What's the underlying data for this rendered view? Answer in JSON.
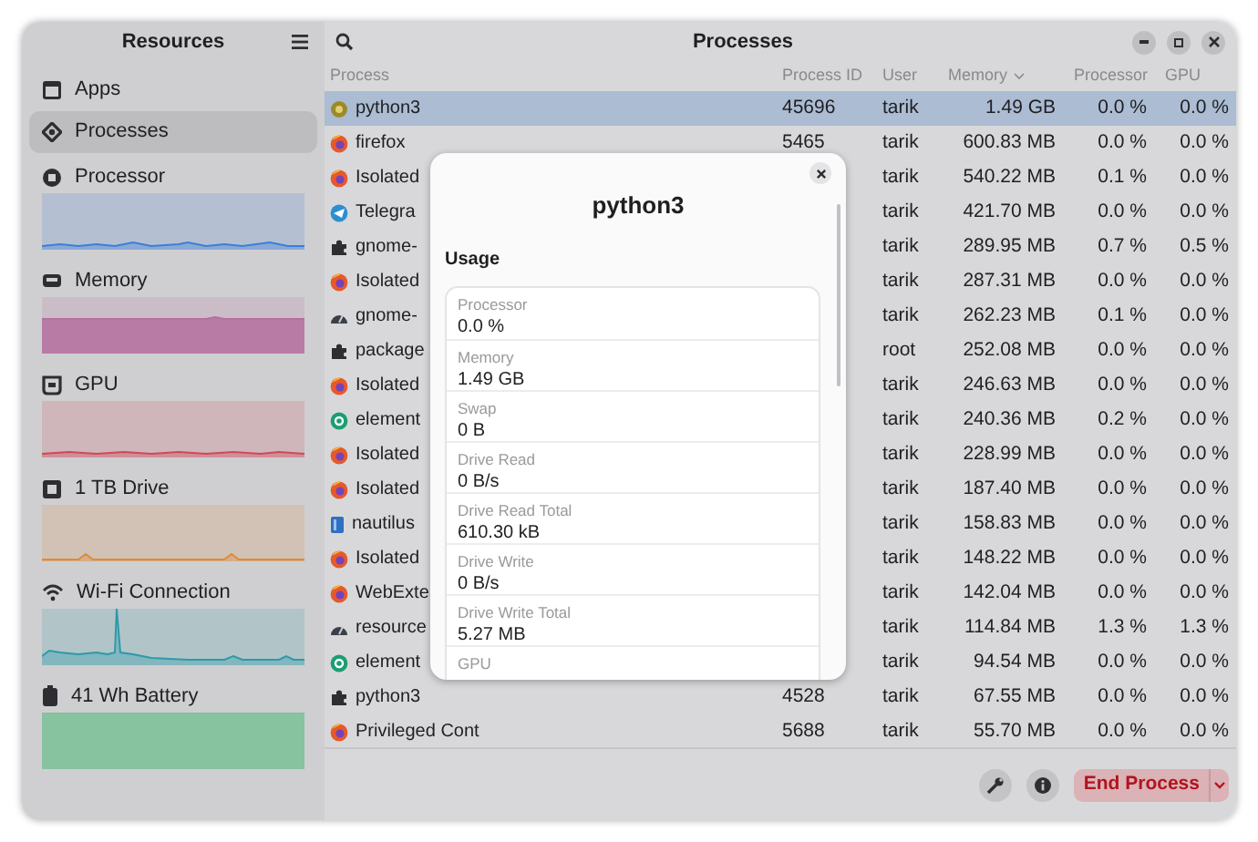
{
  "sidebar": {
    "title": "Resources",
    "nav": [
      {
        "label": "Apps",
        "kind": "apps",
        "selected": false
      },
      {
        "label": "Processes",
        "kind": "processes",
        "selected": true
      }
    ],
    "resources": [
      {
        "label": "Processor",
        "kind": "cpu",
        "color": "#3b7fd9"
      },
      {
        "label": "Memory",
        "kind": "memory",
        "color": "#b5709f"
      },
      {
        "label": "GPU",
        "kind": "gpu",
        "color": "#d0485a"
      },
      {
        "label": "1 TB Drive",
        "kind": "drive",
        "color": "#e08a3a"
      },
      {
        "label": "Wi-Fi Connection",
        "kind": "wifi",
        "color": "#2d9aa8"
      },
      {
        "label": "41 Wh Battery",
        "kind": "battery",
        "color": "#7cc198"
      }
    ]
  },
  "header": {
    "title": "Processes"
  },
  "table": {
    "columns": [
      "Process",
      "Process ID",
      "User",
      "Memory",
      "Processor",
      "GPU"
    ],
    "rows": [
      {
        "kind": "python",
        "name": "python3",
        "pid": "45696",
        "user": "tarik",
        "memory": "1.49 GB",
        "processor": "0.0 %",
        "gpu": "0.0 %",
        "selected": true
      },
      {
        "kind": "firefox",
        "name": "firefox",
        "pid": "5465",
        "user": "tarik",
        "memory": "600.83 MB",
        "processor": "0.0 %",
        "gpu": "0.0 %",
        "selected": false
      },
      {
        "kind": "firefox",
        "name": "Isolated",
        "user": "tarik",
        "memory": "540.22 MB",
        "processor": "0.1 %",
        "gpu": "0.0 %",
        "selected": false
      },
      {
        "kind": "telegram",
        "name": "Telegra",
        "user": "tarik",
        "memory": "421.70 MB",
        "processor": "0.0 %",
        "gpu": "0.0 %",
        "selected": false
      },
      {
        "kind": "puzzle",
        "name": "gnome-",
        "user": "tarik",
        "memory": "289.95 MB",
        "processor": "0.7 %",
        "gpu": "0.5 %",
        "selected": false
      },
      {
        "kind": "firefox",
        "name": "Isolated",
        "user": "tarik",
        "memory": "287.31 MB",
        "processor": "0.0 %",
        "gpu": "0.0 %",
        "selected": false
      },
      {
        "kind": "gauge",
        "name": "gnome-",
        "user": "tarik",
        "memory": "262.23 MB",
        "processor": "0.1 %",
        "gpu": "0.0 %",
        "selected": false
      },
      {
        "kind": "puzzle",
        "name": "package",
        "user": "root",
        "memory": "252.08 MB",
        "processor": "0.0 %",
        "gpu": "0.0 %",
        "selected": false
      },
      {
        "kind": "firefox",
        "name": "Isolated",
        "user": "tarik",
        "memory": "246.63 MB",
        "processor": "0.0 %",
        "gpu": "0.0 %",
        "selected": false
      },
      {
        "kind": "element",
        "name": "element",
        "user": "tarik",
        "memory": "240.36 MB",
        "processor": "0.2 %",
        "gpu": "0.0 %",
        "selected": false
      },
      {
        "kind": "firefox",
        "name": "Isolated",
        "user": "tarik",
        "memory": "228.99 MB",
        "processor": "0.0 %",
        "gpu": "0.0 %",
        "selected": false
      },
      {
        "kind": "firefox",
        "name": "Isolated",
        "user": "tarik",
        "memory": "187.40 MB",
        "processor": "0.0 %",
        "gpu": "0.0 %",
        "selected": false
      },
      {
        "kind": "files",
        "name": "nautilus",
        "user": "tarik",
        "memory": "158.83 MB",
        "processor": "0.0 %",
        "gpu": "0.0 %",
        "selected": false
      },
      {
        "kind": "firefox",
        "name": "Isolated",
        "user": "tarik",
        "memory": "148.22 MB",
        "processor": "0.0 %",
        "gpu": "0.0 %",
        "selected": false
      },
      {
        "kind": "firefox",
        "name": "WebExte",
        "user": "tarik",
        "memory": "142.04 MB",
        "processor": "0.0 %",
        "gpu": "0.0 %",
        "selected": false
      },
      {
        "kind": "gauge",
        "name": "resource",
        "user": "tarik",
        "memory": "114.84 MB",
        "processor": "1.3 %",
        "gpu": "1.3 %",
        "selected": false
      },
      {
        "kind": "element",
        "name": "element",
        "user": "tarik",
        "memory": "94.54 MB",
        "processor": "0.0 %",
        "gpu": "0.0 %",
        "selected": false
      },
      {
        "kind": "puzzle",
        "name": "python3",
        "pid": "4528",
        "user": "tarik",
        "memory": "67.55 MB",
        "processor": "0.0 %",
        "gpu": "0.0 %",
        "selected": false
      },
      {
        "kind": "firefox",
        "name": "Privileged Cont",
        "pid": "5688",
        "user": "tarik",
        "memory": "55.70 MB",
        "processor": "0.0 %",
        "gpu": "0.0 %",
        "selected": false
      }
    ]
  },
  "footer": {
    "end_button": "End Process"
  },
  "dialog": {
    "title": "python3",
    "section": "Usage",
    "items": [
      {
        "label": "Processor",
        "value": "0.0 %"
      },
      {
        "label": "Memory",
        "value": "1.49 GB"
      },
      {
        "label": "Swap",
        "value": "0 B"
      },
      {
        "label": "Drive Read",
        "value": "0 B/s"
      },
      {
        "label": "Drive Read Total",
        "value": "610.30 kB"
      },
      {
        "label": "Drive Write",
        "value": "0 B/s"
      },
      {
        "label": "Drive Write Total",
        "value": "5.27 MB"
      },
      {
        "label": "GPU"
      }
    ]
  }
}
